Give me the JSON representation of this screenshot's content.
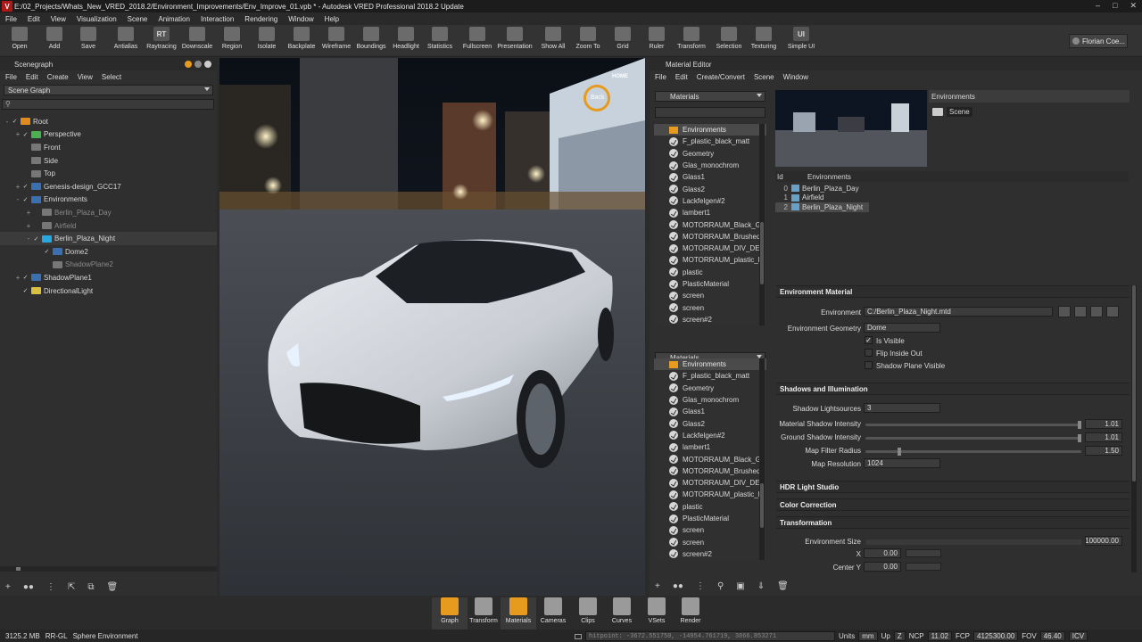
{
  "window": {
    "title": "E:/02_Projects/Whats_New_VRED_2018.2/Environment_Improvements/Env_Improve_01.vpb * - Autodesk VRED Professional 2018.2 Update",
    "logo": "V"
  },
  "menu": [
    "File",
    "Edit",
    "View",
    "Visualization",
    "Scene",
    "Animation",
    "Interaction",
    "Rendering",
    "Window",
    "Help"
  ],
  "toolbar": [
    {
      "label": "Open",
      "icon": "folder-icon"
    },
    {
      "label": "Add",
      "icon": "add-file-icon"
    },
    {
      "label": "Save",
      "icon": "save-icon"
    },
    {
      "label": "Antialias",
      "icon": "antialias-icon"
    },
    {
      "label": "Raytracing",
      "icon": "rt-icon",
      "glyph": "RT"
    },
    {
      "label": "Downscale",
      "icon": "downscale-icon"
    },
    {
      "label": "Region",
      "icon": "region-icon"
    },
    {
      "label": "Isolate",
      "icon": "isolate-icon"
    },
    {
      "label": "Backplate",
      "icon": "backplate-icon"
    },
    {
      "label": "Wireframe",
      "icon": "wireframe-icon"
    },
    {
      "label": "Boundings",
      "icon": "boundings-icon"
    },
    {
      "label": "Headlight",
      "icon": "headlight-icon"
    },
    {
      "label": "Statistics",
      "icon": "statistics-icon"
    },
    {
      "label": "Fullscreen",
      "icon": "fullscreen-icon"
    },
    {
      "label": "Presentation",
      "icon": "presentation-icon"
    },
    {
      "label": "Show All",
      "icon": "show-all-icon"
    },
    {
      "label": "Zoom To",
      "icon": "zoom-to-icon"
    },
    {
      "label": "Grid",
      "icon": "grid-icon"
    },
    {
      "label": "Ruler",
      "icon": "ruler-icon"
    },
    {
      "label": "Transform",
      "icon": "transform-icon"
    },
    {
      "label": "Selection",
      "icon": "selection-icon"
    },
    {
      "label": "Texturing",
      "icon": "texturing-icon"
    },
    {
      "label": "Simple UI",
      "icon": "simple-ui-icon",
      "glyph": "UI"
    }
  ],
  "user": {
    "name": "Florian Coe..."
  },
  "scenegraph": {
    "title": "Scenegraph",
    "menu": [
      "File",
      "Edit",
      "Create",
      "View",
      "Select"
    ],
    "dropdown": "Scene Graph",
    "nodes": [
      {
        "label": "Root",
        "color": "#e08a20",
        "dim": false
      },
      {
        "label": "Perspective",
        "color": "#4caf50",
        "dim": false
      },
      {
        "label": "Front",
        "color": "#777777",
        "dim": false
      },
      {
        "label": "Side",
        "color": "#777777",
        "dim": false
      },
      {
        "label": "Top",
        "color": "#777777",
        "dim": false
      },
      {
        "label": "Genesis-design_GCC17",
        "color": "#3a6fb0",
        "dim": false
      },
      {
        "label": "Environments",
        "color": "#3a6fb0",
        "dim": false
      },
      {
        "label": "Berlin_Plaza_Day",
        "color": "#777777",
        "dim": true
      },
      {
        "label": "Airfield",
        "color": "#777777",
        "dim": true
      },
      {
        "label": "Berlin_Plaza_Night",
        "color": "#29a8e0",
        "dim": false
      },
      {
        "label": "Dome2",
        "color": "#3a6fb0",
        "dim": false
      },
      {
        "label": "ShadowPlane2",
        "color": "#777777",
        "dim": true
      },
      {
        "label": "ShadowPlane1",
        "color": "#3a6fb0",
        "dim": false
      },
      {
        "label": "DirectionalLight",
        "color": "#d8c040",
        "dim": false
      }
    ]
  },
  "viewport": {
    "navcube": "Back",
    "home": "HOME"
  },
  "material_editor": {
    "title": "Material Editor",
    "menu": [
      "File",
      "Edit",
      "Create/Convert",
      "Scene",
      "Window"
    ],
    "list_dropdown": "Materials",
    "list1": [
      "Environments",
      "F_plastic_black_matt",
      "Geometry",
      "Glas_monochrom",
      "Glass1",
      "Glass2",
      "Lackfelgen#2",
      "lambert1",
      "MOTORRAUM_Black_Gl",
      "MOTORRAUM_Brushed",
      "MOTORRAUM_DIV_DEC",
      "MOTORRAUM_plastic_b",
      "plastic",
      "PlasticMaterial",
      "screen",
      "screen",
      "screen#2"
    ],
    "list2": [
      "Environments",
      "F_plastic_black_matt",
      "Geometry",
      "Glas_monochrom",
      "Glass1",
      "Glass2",
      "Lackfelgen#2",
      "lambert1",
      "MOTORRAUM_Black_Gl",
      "MOTORRAUM_Brushed",
      "MOTORRAUM_DIV_DEC",
      "MOTORRAUM_plastic_b",
      "plastic",
      "PlasticMaterial",
      "screen",
      "screen",
      "screen#2"
    ],
    "preview_header": "Environments",
    "scene_button": "Scene",
    "env_table": {
      "col_id": "Id",
      "col_name": "Environments",
      "rows": [
        {
          "id": "0",
          "name": "Berlin_Plaza_Day"
        },
        {
          "id": "1",
          "name": "Airfield"
        },
        {
          "id": "2",
          "name": "Berlin_Plaza_Night"
        }
      ]
    },
    "sections": {
      "env_material": "Environment Material",
      "shadows": "Shadows and Illumination",
      "hdr": "HDR Light Studio",
      "color": "Color Correction",
      "transform": "Transformation"
    },
    "props": {
      "environment_label": "Environment",
      "environment_value": "C:/Berlin_Plaza_Night.mtd",
      "geometry_label": "Environment Geometry",
      "geometry_value": "Dome",
      "is_visible": "Is Visible",
      "flip_inside": "Flip Inside Out",
      "shadow_plane": "Shadow Plane Visible",
      "shadow_lightsources_label": "Shadow Lightsources",
      "shadow_lightsources_value": "3",
      "material_shadow_label": "Material Shadow Intensity",
      "material_shadow_value": "1.01",
      "material_shadow_fill": 1.0,
      "ground_shadow_label": "Ground Shadow Intensity",
      "ground_shadow_value": "1.01",
      "ground_shadow_fill": 1.0,
      "map_filter_label": "Map Filter Radius",
      "map_filter_value": "1.50",
      "map_filter_fill": 0.15,
      "map_res_label": "Map Resolution",
      "map_res_value": "1024",
      "env_size_label": "Environment Size",
      "env_size_value": "100000.00",
      "x_label": "X",
      "x_value": "0.00",
      "center_y_label": "Center Y",
      "center_y_value": "0.00"
    }
  },
  "dock": [
    {
      "label": "Graph",
      "icon": "graph-icon",
      "color": "#e69a1e"
    },
    {
      "label": "Transform",
      "icon": "transform-icon",
      "color": "#9a9a9a"
    },
    {
      "label": "Materials",
      "icon": "materials-icon",
      "color": "#e69a1e"
    },
    {
      "label": "Cameras",
      "icon": "cameras-icon",
      "color": "#9a9a9a"
    },
    {
      "label": "Clips",
      "icon": "clips-icon",
      "color": "#9a9a9a"
    },
    {
      "label": "Curves",
      "icon": "curves-icon",
      "color": "#9a9a9a"
    },
    {
      "label": "VSets",
      "icon": "vsets-icon",
      "color": "#9a9a9a"
    },
    {
      "label": "Render",
      "icon": "render-icon",
      "color": "#9a9a9a"
    }
  ],
  "status": {
    "memory": "3125.2 MB",
    "mode": "RR-GL",
    "env": "Sphere Environment",
    "hitpoint": "hitpoint: -3672.551750, -14954.761719, 3866.853271",
    "units_label": "Units",
    "units_value": "mm",
    "up_label": "Up",
    "up_value": "Z",
    "ncp_label": "NCP",
    "ncp_value": "11.02",
    "fcp_label": "FCP",
    "fcp_value": "4125300.00",
    "fov_label": "FOV",
    "fov_value": "46.40",
    "icv": "ICV"
  }
}
